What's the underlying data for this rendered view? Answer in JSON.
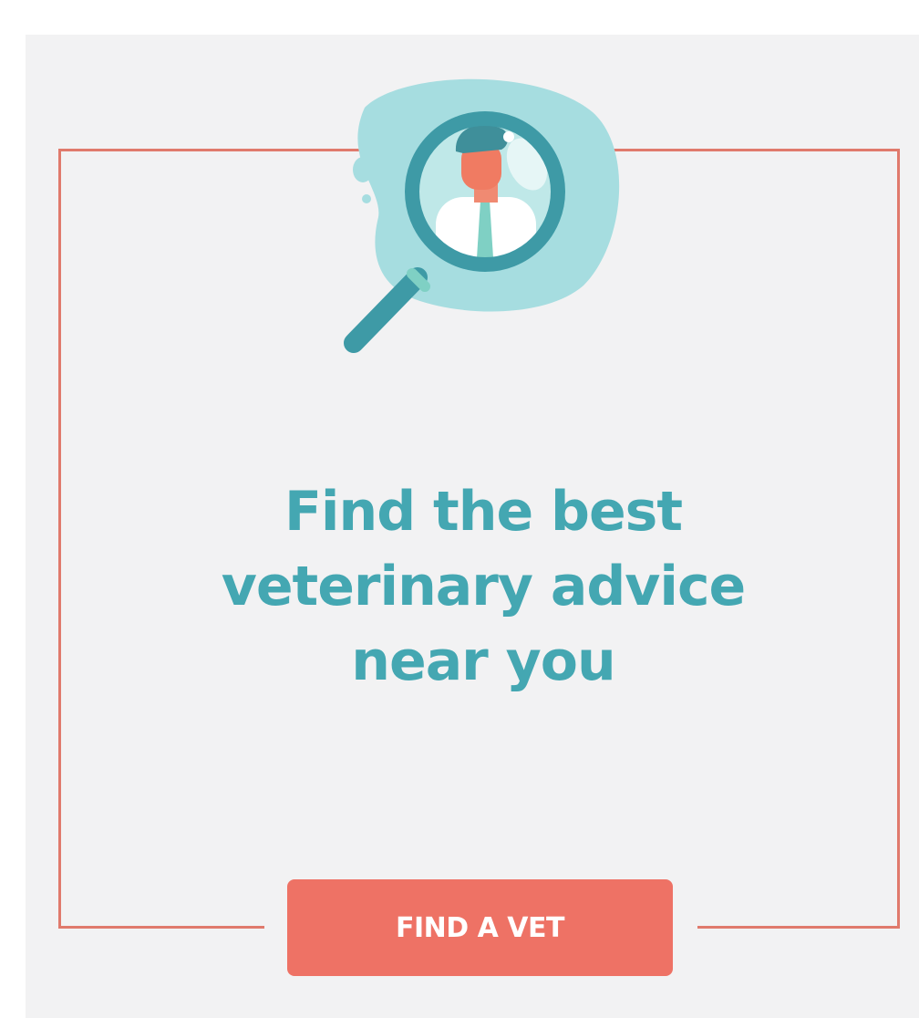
{
  "headline": {
    "line1": "Find the best",
    "line2": "veterinary advice",
    "line3": "near you"
  },
  "cta": {
    "label": "FIND A VET"
  },
  "illustration": {
    "icon": "magnifier-vet-icon"
  },
  "colors": {
    "background": "#f2f2f3",
    "frame": "#e07a6c",
    "headline": "#44a7b2",
    "button": "#ee7265",
    "button_text": "#ffffff",
    "blob": "#a6dde0"
  }
}
